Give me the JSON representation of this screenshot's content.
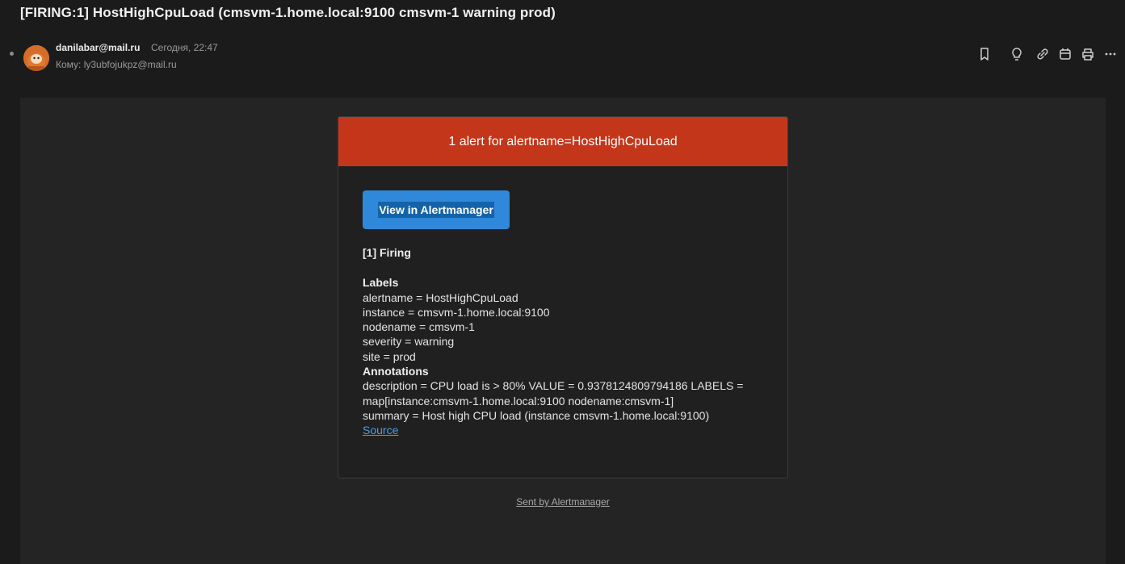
{
  "email": {
    "subject": "[FIRING:1] HostHighCpuLoad (cmsvm-1.home.local:9100 cmsvm-1 warning prod)",
    "from": "danilabar@mail.ru",
    "date": "Сегодня, 22:47",
    "to": "Кому: ly3ubfojukpz@mail.ru"
  },
  "toolbar": {
    "icons": [
      "bookmark-icon",
      "lightbulb-icon",
      "link-icon",
      "calendar-icon",
      "print-icon",
      "more-icon"
    ]
  },
  "alert": {
    "header": "1 alert for alertname=HostHighCpuLoad",
    "button_label": "View in Alertmanager",
    "firing_title": "[1] Firing",
    "labels_title": "Labels",
    "labels": [
      "alertname = HostHighCpuLoad",
      "instance = cmsvm-1.home.local:9100",
      "nodename = cmsvm-1",
      "severity = warning",
      "site = prod"
    ],
    "annotations_title": "Annotations",
    "annotations": [
      "description = CPU load is > 80% VALUE = 0.9378124809794186 LABELS =",
      "map[instance:cmsvm-1.home.local:9100 nodename:cmsvm-1]",
      "summary = Host high CPU load (instance cmsvm-1.home.local:9100)"
    ],
    "source_link": "Source",
    "footer_link": "Sent by Alertmanager"
  },
  "colors": {
    "header_bg": "#c4361a",
    "button_bg": "#2f88d9",
    "link": "#4a9fe8",
    "page_bg": "#1b1b1b"
  }
}
